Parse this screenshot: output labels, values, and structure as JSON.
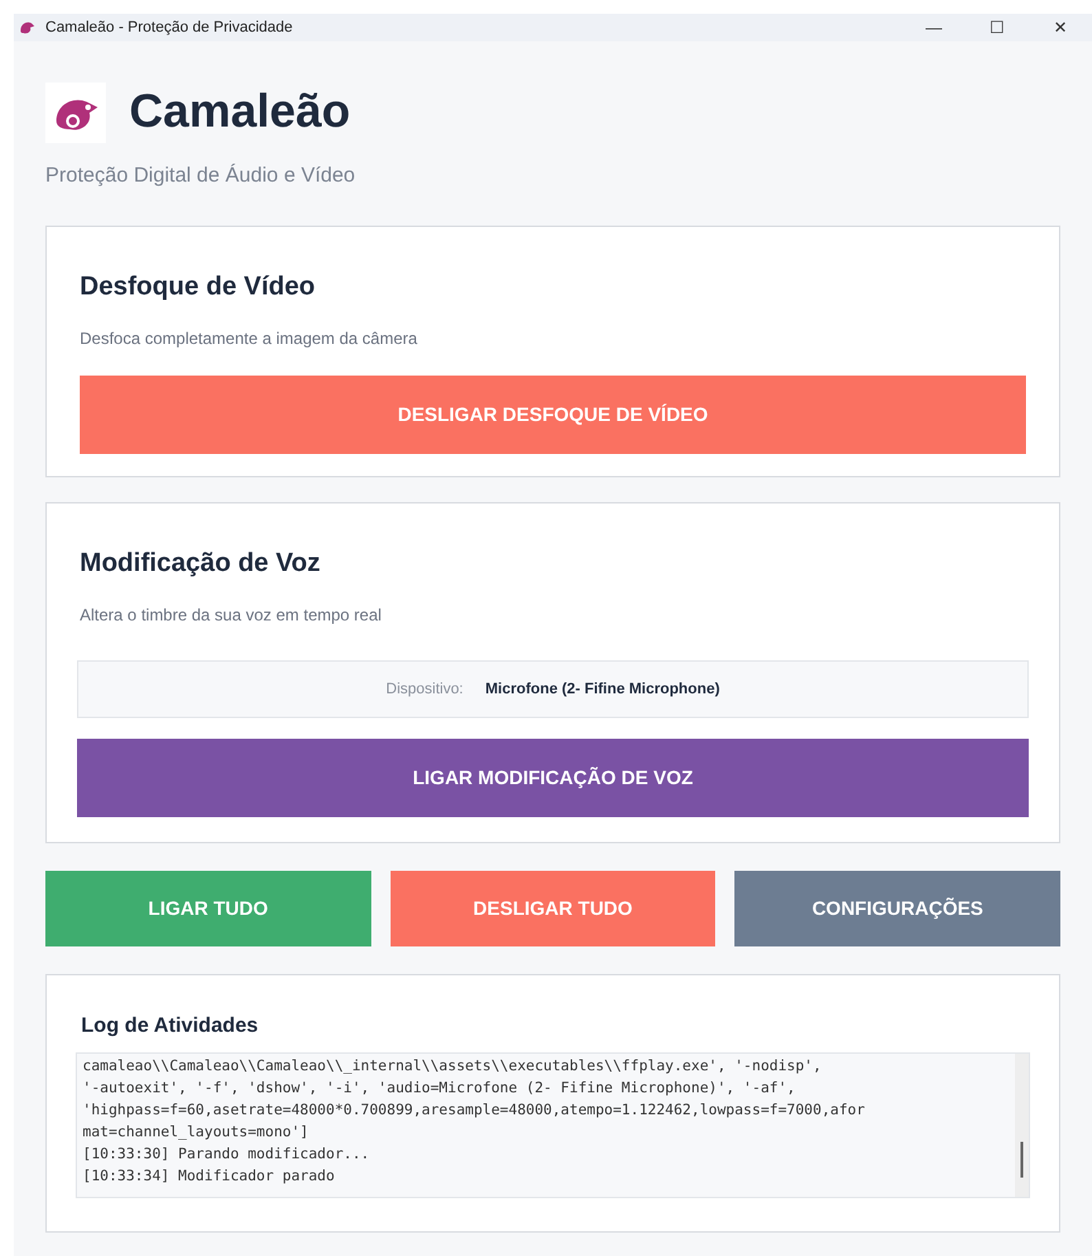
{
  "window": {
    "title": "Camaleão - Proteção de Privacidade",
    "controls": [
      "—",
      "☐",
      "✕"
    ]
  },
  "header": {
    "title": "Camaleão",
    "subtitle": "Proteção Digital de Áudio e Vídeo"
  },
  "video_card": {
    "title": "Desfoque de Vídeo",
    "description": "Desfoca completamente a imagem da câmera",
    "button": {
      "label": "DESLIGAR DESFOQUE DE VÍDEO",
      "kind": "danger"
    }
  },
  "voice_card": {
    "title": "Modificação de Voz",
    "description": "Altera o timbre da sua voz em tempo real",
    "device_label": "Dispositivo:",
    "device_value": "Microfone (2- Fifine Microphone)",
    "button": {
      "label": "LIGAR MODIFICAÇÃO DE VOZ",
      "kind": "primary"
    }
  },
  "actions": [
    {
      "label": "LIGAR TUDO",
      "kind": "success"
    },
    {
      "label": "DESLIGAR TUDO",
      "kind": "danger"
    },
    {
      "label": "CONFIGURAÇÕES",
      "kind": "secondary"
    }
  ],
  "log": {
    "title": "Log de Atividades",
    "lines": [
      "camaleao\\\\Camaleao\\\\Camaleao\\\\_internal\\\\assets\\\\executables\\\\ffplay.exe', '-nodisp',",
      "'-autoexit', '-f', 'dshow', '-i', 'audio=Microfone (2- Fifine Microphone)', '-af',",
      "'highpass=f=60,asetrate=48000*0.700899,aresample=48000,atempo=1.122462,lowpass=f=7000,afor",
      "mat=channel_layouts=mono']",
      "[10:33:30] Parando modificador...",
      "[10:33:34] Modificador parado"
    ]
  }
}
